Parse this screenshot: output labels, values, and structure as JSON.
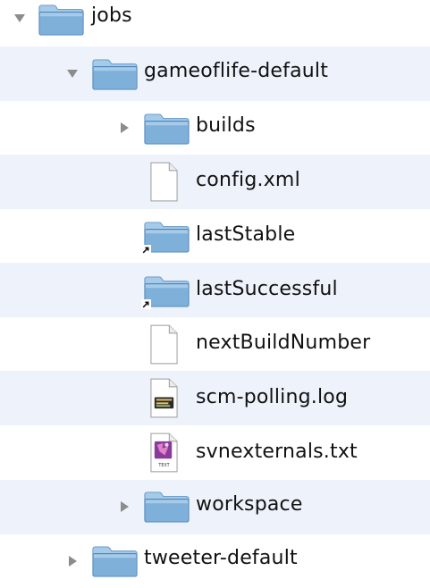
{
  "colors": {
    "alt_row": "#eef2fb",
    "folder_body": "#7fb0da",
    "folder_tab": "#a6cbe9",
    "disclosure": "#8c8c8c"
  },
  "tree": {
    "jobs": {
      "label": "jobs",
      "icon": "folder-icon",
      "expanded": true
    },
    "gameoflife_default": {
      "label": "gameoflife-default",
      "icon": "folder-icon",
      "expanded": true
    },
    "builds": {
      "label": "builds",
      "icon": "folder-icon",
      "expanded": false
    },
    "config_xml": {
      "label": "config.xml",
      "icon": "document-icon"
    },
    "last_stable": {
      "label": "lastStable",
      "icon": "folder-alias-icon"
    },
    "last_successful": {
      "label": "lastSuccessful",
      "icon": "folder-alias-icon"
    },
    "next_build_number": {
      "label": "nextBuildNumber",
      "icon": "document-icon"
    },
    "scm_polling_log": {
      "label": "scm-polling.log",
      "icon": "log-file-icon"
    },
    "svnexternals_txt": {
      "label": "svnexternals.txt",
      "icon": "text-file-icon",
      "badge": "TEXT"
    },
    "workspace": {
      "label": "workspace",
      "icon": "folder-icon",
      "expanded": false
    },
    "tweeter_default": {
      "label": "tweeter-default",
      "icon": "folder-icon",
      "expanded": false
    }
  }
}
